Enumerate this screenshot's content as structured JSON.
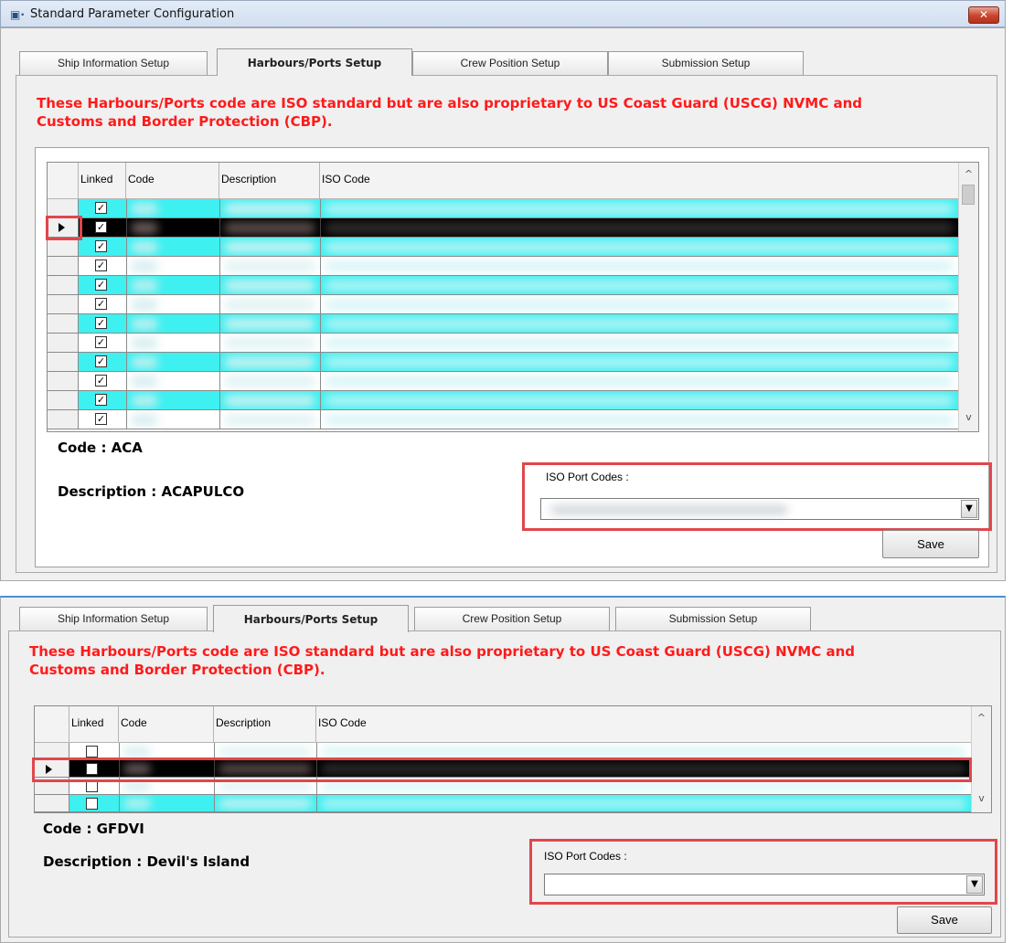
{
  "window": {
    "title": "Standard Parameter Configuration",
    "app_icon": "app-window-icon",
    "close_glyph": "✕"
  },
  "colors": {
    "notice_red": "#ff1a1a",
    "row_cyan": "#3ef0f0",
    "highlight_red": "#e0474c",
    "selected_row": "#000000"
  },
  "tabs": [
    {
      "label": "Ship Information Setup",
      "active": false
    },
    {
      "label": "Harbours/Ports Setup",
      "active": true
    },
    {
      "label": "Crew Position Setup",
      "active": false
    },
    {
      "label": "Submission Setup",
      "active": false
    }
  ],
  "notice": {
    "line1": "These Harbours/Ports code are ISO standard but are also proprietary to US Coast Guard (USCG) NVMC and",
    "line2": "Customs and Border Protection (CBP)."
  },
  "grid": {
    "columns": [
      "Linked",
      "Code",
      "Description",
      "ISO Code"
    ]
  },
  "top": {
    "rows": [
      {
        "linked": true,
        "selected": false,
        "cyan": true
      },
      {
        "linked": true,
        "selected": true,
        "cyan": false
      },
      {
        "linked": true,
        "selected": false,
        "cyan": true
      },
      {
        "linked": true,
        "selected": false,
        "cyan": false
      },
      {
        "linked": true,
        "selected": false,
        "cyan": true
      },
      {
        "linked": true,
        "selected": false,
        "cyan": false
      },
      {
        "linked": true,
        "selected": false,
        "cyan": true
      },
      {
        "linked": true,
        "selected": false,
        "cyan": false
      },
      {
        "linked": true,
        "selected": false,
        "cyan": true
      },
      {
        "linked": true,
        "selected": false,
        "cyan": false
      },
      {
        "linked": true,
        "selected": false,
        "cyan": true
      },
      {
        "linked": true,
        "selected": false,
        "cyan": false
      }
    ],
    "code_text": "Code : ACA",
    "description_text": "Description : ACAPULCO",
    "iso_label": "ISO Port Codes :",
    "save_label": "Save"
  },
  "bottom": {
    "rows": [
      {
        "linked": false,
        "selected": false,
        "cyan": false
      },
      {
        "linked": false,
        "selected": true,
        "cyan": false
      },
      {
        "linked": false,
        "selected": false,
        "cyan": false
      },
      {
        "linked": false,
        "selected": false,
        "cyan": true
      }
    ],
    "code_text": "Code : GFDVI",
    "description_text": "Description : Devil's Island",
    "iso_label": "ISO Port Codes :",
    "save_label": "Save"
  },
  "icons": {
    "check": "✓",
    "scroll_up": "^",
    "scroll_down": "v",
    "dropdown": "▼"
  }
}
